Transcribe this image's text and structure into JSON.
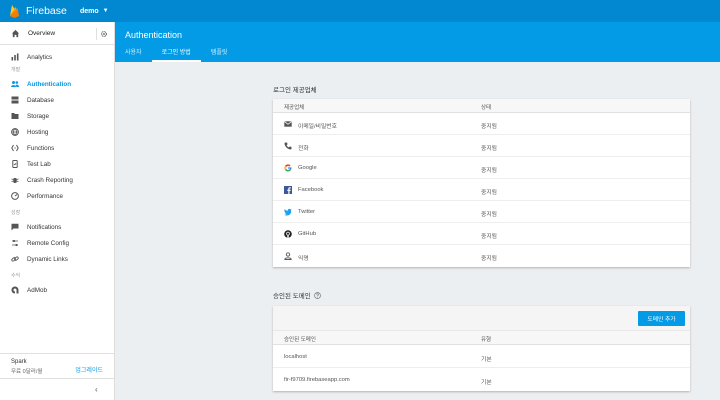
{
  "topbar": {
    "app_name": "Firebase",
    "project": "demo"
  },
  "sidebar": {
    "overview": "Overview",
    "items_top": [
      {
        "label": "Analytics",
        "icon": "bar-chart-icon"
      }
    ],
    "sections": [
      {
        "title": "개발",
        "items": [
          {
            "label": "Authentication",
            "icon": "people-icon",
            "active": true
          },
          {
            "label": "Database",
            "icon": "database-icon"
          },
          {
            "label": "Storage",
            "icon": "storage-icon"
          },
          {
            "label": "Hosting",
            "icon": "hosting-icon"
          },
          {
            "label": "Functions",
            "icon": "functions-icon"
          },
          {
            "label": "Test Lab",
            "icon": "testlab-icon"
          },
          {
            "label": "Crash Reporting",
            "icon": "bug-icon"
          },
          {
            "label": "Performance",
            "icon": "performance-icon"
          }
        ]
      },
      {
        "title": "성장",
        "items": [
          {
            "label": "Notifications",
            "icon": "chat-icon"
          },
          {
            "label": "Remote Config",
            "icon": "remote-config-icon"
          },
          {
            "label": "Dynamic Links",
            "icon": "link-icon"
          }
        ]
      },
      {
        "title": "수익",
        "items": [
          {
            "label": "AdMob",
            "icon": "admob-icon"
          }
        ]
      }
    ],
    "plan": {
      "name": "Spark",
      "desc": "무료 0달러/월",
      "upgrade": "업그레이드"
    },
    "collapse": "‹"
  },
  "header": {
    "title": "Authentication",
    "tabs": [
      "사용자",
      "로그인 방법",
      "템플릿"
    ],
    "active_tab": 1
  },
  "providers": {
    "title": "로그인 제공업체",
    "col_provider": "제공업체",
    "col_status": "상태",
    "rows": [
      {
        "name": "이메일/비밀번호",
        "status": "중지됨",
        "icon": "mail-icon"
      },
      {
        "name": "전화",
        "status": "중지됨",
        "icon": "phone-icon"
      },
      {
        "name": "Google",
        "status": "중지됨",
        "icon": "google-icon"
      },
      {
        "name": "Facebook",
        "status": "중지됨",
        "icon": "facebook-icon"
      },
      {
        "name": "Twitter",
        "status": "중지됨",
        "icon": "twitter-icon"
      },
      {
        "name": "GitHub",
        "status": "중지됨",
        "icon": "github-icon"
      },
      {
        "name": "익명",
        "status": "중지됨",
        "icon": "anonymous-icon"
      }
    ]
  },
  "domains": {
    "title": "승인된 도메인",
    "add_button": "도메인 추가",
    "col_domain": "승인된 도메인",
    "col_type": "유형",
    "rows": [
      {
        "domain": "localhost",
        "type": "기본"
      },
      {
        "domain": "fir-f9709.firebaseapp.com",
        "type": "기본"
      }
    ]
  },
  "colors": {
    "topbar": "#0288d1",
    "header": "#039be5",
    "accent": "#039be5",
    "background": "#eceff1"
  }
}
